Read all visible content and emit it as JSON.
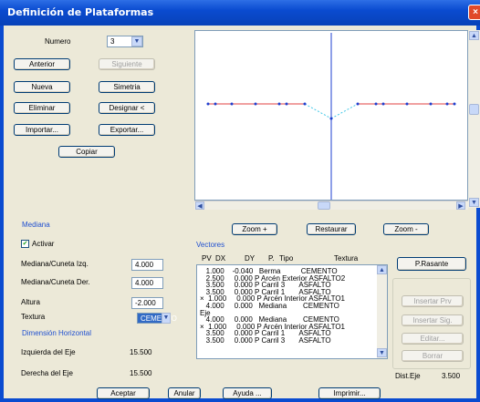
{
  "window": {
    "title": "Definición de Plataformas",
    "close": "×"
  },
  "numero": {
    "label": "Numero",
    "value": "3"
  },
  "buttons": {
    "anterior": "Anterior",
    "siguiente": "Siguiente",
    "nueva": "Nueva",
    "simetria": "Simetria",
    "eliminar": "Eliminar",
    "designar": "Designar <",
    "importar": "Importar...",
    "exportar": "Exportar...",
    "copiar": "Copiar",
    "zoom_in": "Zoom +",
    "restaurar": "Restaurar",
    "zoom_out": "Zoom -",
    "p_rasante": "P.Rasante",
    "insertar_prv": "Insertar Prv",
    "insertar_sig": "Insertar Sig.",
    "editar": "Editar...",
    "borrar": "Borrar",
    "aceptar": "Aceptar",
    "anular": "Anular",
    "ayuda": "Ayuda ...",
    "imprimir": "Imprimir..."
  },
  "mediana": {
    "title": "Mediana",
    "activar": "Activar",
    "cuneta_izq_label": "Mediana/Cuneta Izq.",
    "cuneta_izq": "4.000",
    "cuneta_der_label": "Mediana/Cuneta Der.",
    "cuneta_der": "4.000",
    "altura_label": "Altura",
    "altura": "-2.000",
    "textura_label": "Textura",
    "textura": "CEMENTO"
  },
  "dimension": {
    "title": "Dimensión Horizontal",
    "izq_label": "Izquierda del Eje",
    "izq": "15.500",
    "der_label": "Derecha del Eje",
    "der": "15.500"
  },
  "vectores": {
    "title": "Vectores",
    "headers": {
      "pv": "PV",
      "dx": "DX",
      "dy": "DY",
      "p": "P.",
      "tipo": "Tipo",
      "textura": "Textura"
    },
    "rows": [
      "   1.000    -0.040   Berma          CEMENTO",
      "   2.500     0.000 P Arcén Exterior ASFALTO2",
      "   3.500     0.000 P Carril 3       ASFALTO",
      "   3.500     0.000 P Carril 1       ASFALTO",
      "×  1.000     0.000 P Arcén Interior ASFALTO1",
      "   4.000     0.000   Mediana        CEMENTO",
      "Eje",
      "   4.000     0.000   Mediana        CEMENTO",
      "×  1.000     0.000 P Arcén Interior ASFALTO1",
      "   3.500     0.000 P Carril 1       ASFALTO",
      "   3.500     0.000 P Carril 3       ASFALTO"
    ],
    "dist_eje_label": "Dist.Eje",
    "dist_eje": "3.500"
  },
  "colors": {
    "titlebar": "#0A4BD0",
    "profile_gray": "#888888",
    "profile_red": "#E04040",
    "profile_blue": "#1E3FD0",
    "median_cyan": "#40C8E8"
  }
}
